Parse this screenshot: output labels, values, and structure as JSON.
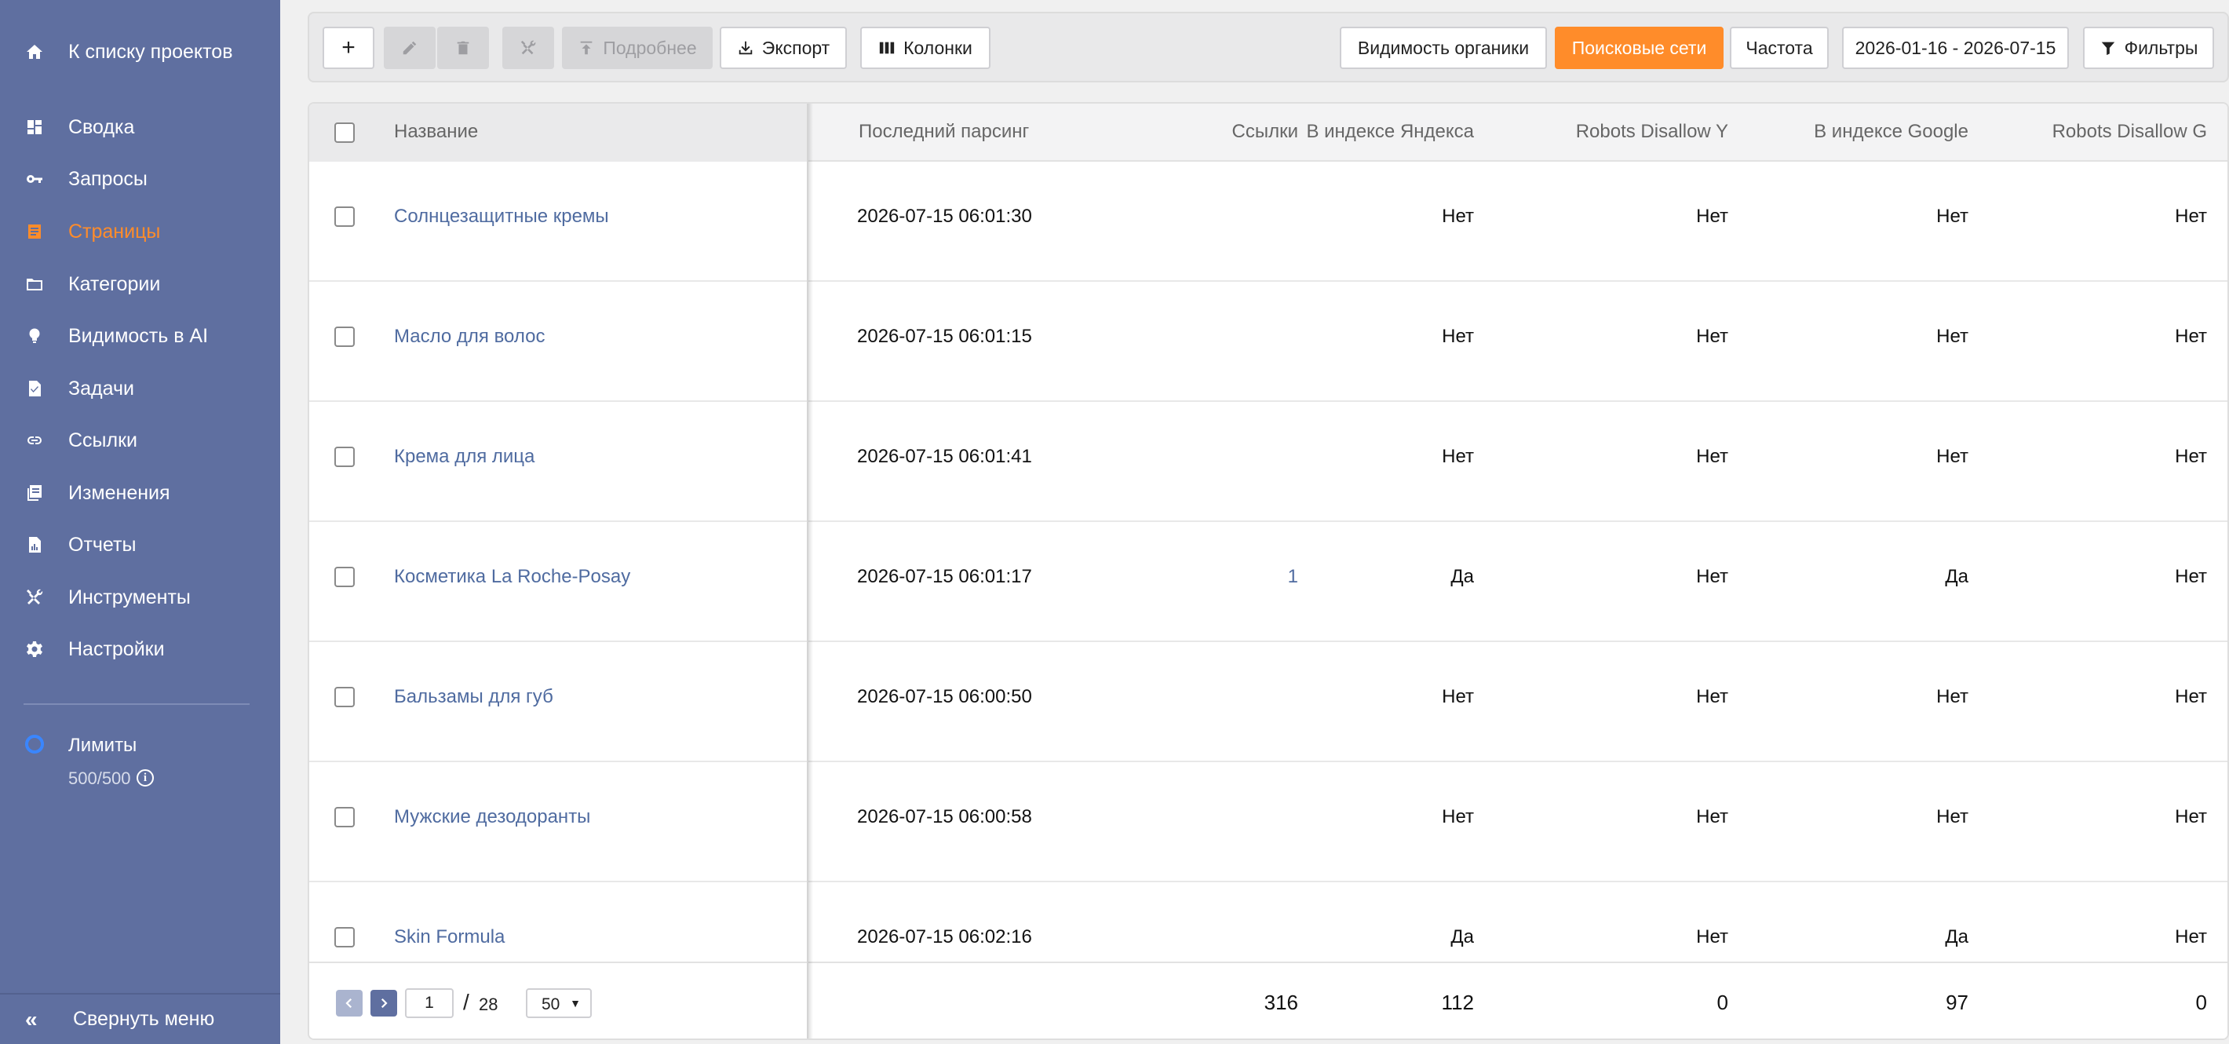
{
  "sidebar": {
    "back_link": "К списку проектов",
    "items": [
      {
        "label": "Сводка",
        "icon": "dashboard-icon"
      },
      {
        "label": "Запросы",
        "icon": "key-icon"
      },
      {
        "label": "Страницы",
        "icon": "pages-icon",
        "active": true
      },
      {
        "label": "Категории",
        "icon": "folder-icon"
      },
      {
        "label": "Видимость в AI",
        "icon": "bulb-icon"
      },
      {
        "label": "Задачи",
        "icon": "task-icon"
      },
      {
        "label": "Ссылки",
        "icon": "link-icon"
      },
      {
        "label": "Изменения",
        "icon": "changes-icon"
      },
      {
        "label": "Отчеты",
        "icon": "report-icon"
      },
      {
        "label": "Инструменты",
        "icon": "tools-icon"
      },
      {
        "label": "Настройки",
        "icon": "gear-icon"
      }
    ],
    "limits_title": "Лимиты",
    "limits_value": "500/500",
    "collapse_label": "Свернуть меню"
  },
  "toolbar": {
    "add": "+",
    "details": "Подробнее",
    "export": "Экспорт",
    "columns": "Колонки",
    "organic_visibility": "Видимость органики",
    "search_networks": "Поисковые сети",
    "frequency": "Частота",
    "date_range": "2026-01-16 - 2026-07-15",
    "filters": "Фильтры"
  },
  "table": {
    "columns": {
      "name": "Название",
      "last_parse": "Последний парсинг",
      "links": "Ссылки",
      "yandex_index": "В индексе Яндекса",
      "robots_y": "Robots Disallow Y",
      "google_index": "В индексе Google",
      "robots_g": "Robots Disallow G"
    },
    "rows": [
      {
        "name": "Солнцезащитные кремы",
        "last_parse": "2026-07-15 06:01:30",
        "links": "",
        "yandex_index": "Нет",
        "robots_y": "Нет",
        "google_index": "Нет",
        "robots_g": "Нет"
      },
      {
        "name": "Масло для волос",
        "last_parse": "2026-07-15 06:01:15",
        "links": "",
        "yandex_index": "Нет",
        "robots_y": "Нет",
        "google_index": "Нет",
        "robots_g": "Нет"
      },
      {
        "name": "Крема для лица",
        "last_parse": "2026-07-15 06:01:41",
        "links": "",
        "yandex_index": "Нет",
        "robots_y": "Нет",
        "google_index": "Нет",
        "robots_g": "Нет"
      },
      {
        "name": "Косметика La Roche-Posay",
        "last_parse": "2026-07-15 06:01:17",
        "links": "1",
        "yandex_index": "Да",
        "robots_y": "Нет",
        "google_index": "Да",
        "robots_g": "Нет"
      },
      {
        "name": "Бальзамы для губ",
        "last_parse": "2026-07-15 06:00:50",
        "links": "",
        "yandex_index": "Нет",
        "robots_y": "Нет",
        "google_index": "Нет",
        "robots_g": "Нет"
      },
      {
        "name": "Мужские дезодоранты",
        "last_parse": "2026-07-15 06:00:58",
        "links": "",
        "yandex_index": "Нет",
        "robots_y": "Нет",
        "google_index": "Нет",
        "robots_g": "Нет"
      },
      {
        "name": "Skin Formula",
        "last_parse": "2026-07-15 06:02:16",
        "links": "",
        "yandex_index": "Да",
        "robots_y": "Нет",
        "google_index": "Да",
        "robots_g": "Нет"
      }
    ],
    "footer": {
      "links": "316",
      "yandex_index": "112",
      "robots_y": "0",
      "google_index": "97",
      "robots_g": "0"
    },
    "pagination": {
      "current_page": "1",
      "separator": "/",
      "total_pages": "28",
      "page_size": "50"
    }
  },
  "colors": {
    "sidebar_bg": "#5f6fa0",
    "accent": "#ff8c2a",
    "link": "#4f6ba0"
  }
}
